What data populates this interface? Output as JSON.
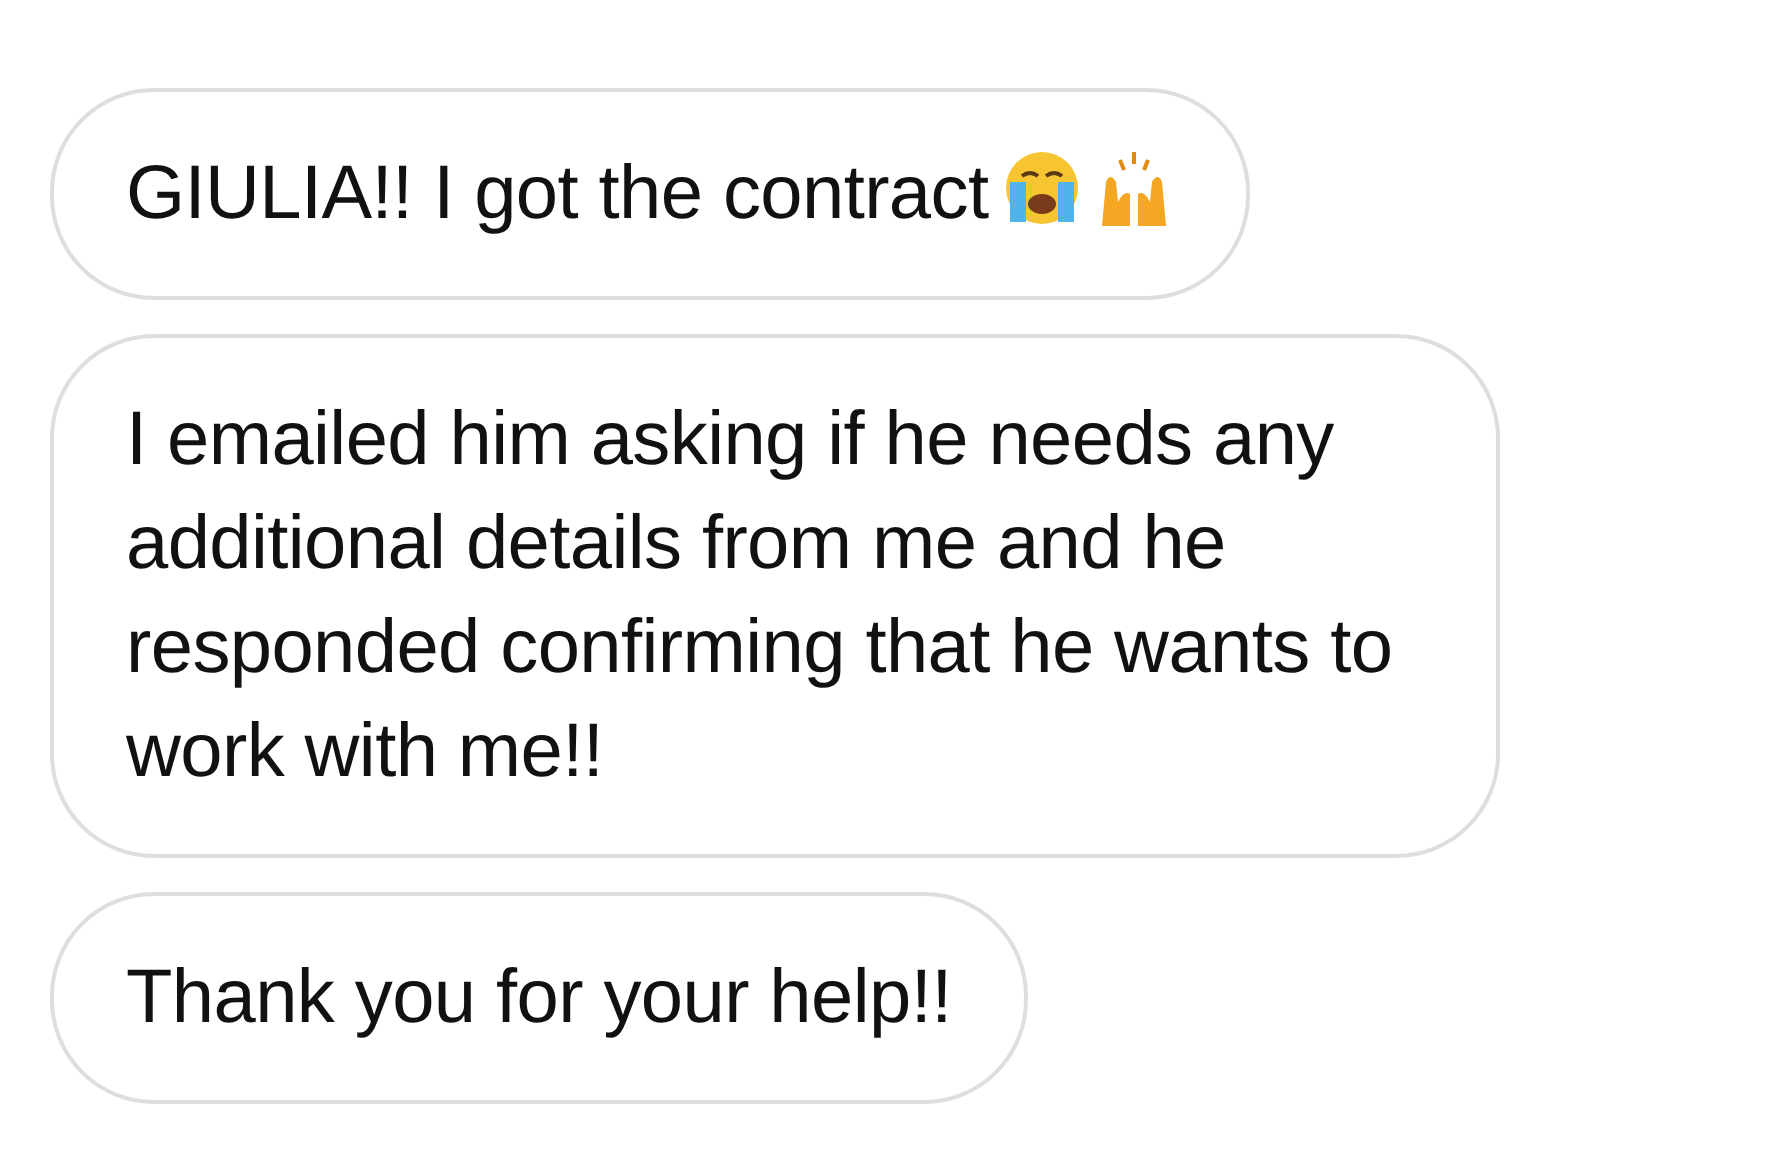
{
  "messages": [
    {
      "text": "GIULIA!! I got the contract",
      "icons": [
        {
          "kind": "crying"
        },
        {
          "kind": "hands"
        }
      ]
    },
    {
      "text": "I emailed him asking if he needs any additional details from me and he responded confirming that he wants to work with me!!"
    },
    {
      "text": "Thank you for your help!!"
    }
  ]
}
